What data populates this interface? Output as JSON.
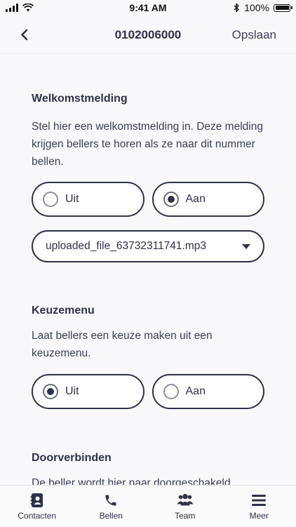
{
  "status_bar": {
    "time": "9:41 AM",
    "battery": "100%"
  },
  "nav": {
    "title": "0102006000",
    "save_label": "Opslaan"
  },
  "sections": [
    {
      "heading": "Welkomstmelding",
      "description": "Stel hier een welkomstmelding in. Deze melding krijgen bellers te horen als ze naar dit nummer bellen.",
      "options": [
        {
          "label": "Uit",
          "selected": false
        },
        {
          "label": "Aan",
          "selected": true
        }
      ],
      "select_value": "uploaded_file_63732311741.mp3"
    },
    {
      "heading": "Keuzemenu",
      "description": "Laat bellers een keuze maken uit een keuzemenu.",
      "options": [
        {
          "label": "Uit",
          "selected": true
        },
        {
          "label": "Aan",
          "selected": false
        }
      ]
    },
    {
      "heading": "Doorverbinden",
      "description": "De beller wordt hier naar doorgeschakeld"
    }
  ],
  "tabs": [
    {
      "label": "Contacten",
      "icon": "contacts-book-icon"
    },
    {
      "label": "Bellen",
      "icon": "phone-icon"
    },
    {
      "label": "Team",
      "icon": "team-icon"
    },
    {
      "label": "Meer",
      "icon": "hamburger-menu-icon"
    }
  ],
  "colors": {
    "primary": "#2f3147",
    "background": "#f8f8fa"
  }
}
